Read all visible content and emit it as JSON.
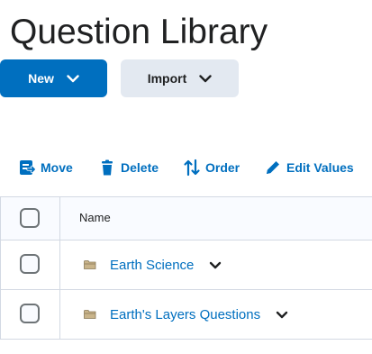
{
  "page": {
    "title": "Question Library"
  },
  "actions": {
    "new_label": "New",
    "import_label": "Import"
  },
  "toolbar": {
    "move_label": "Move",
    "delete_label": "Delete",
    "order_label": "Order",
    "edit_values_label": "Edit Values"
  },
  "table": {
    "columns": [
      "Name"
    ],
    "rows": [
      {
        "name": "Earth Science",
        "type_icon": "folder-icon"
      },
      {
        "name": "Earth's Layers Questions",
        "type_icon": "folder-icon"
      }
    ]
  },
  "colors": {
    "primary": "#006fbf",
    "secondary_button": "#e3e9f1",
    "text": "#202122",
    "border": "#d3d9e3",
    "folder": "#c9b48a"
  }
}
